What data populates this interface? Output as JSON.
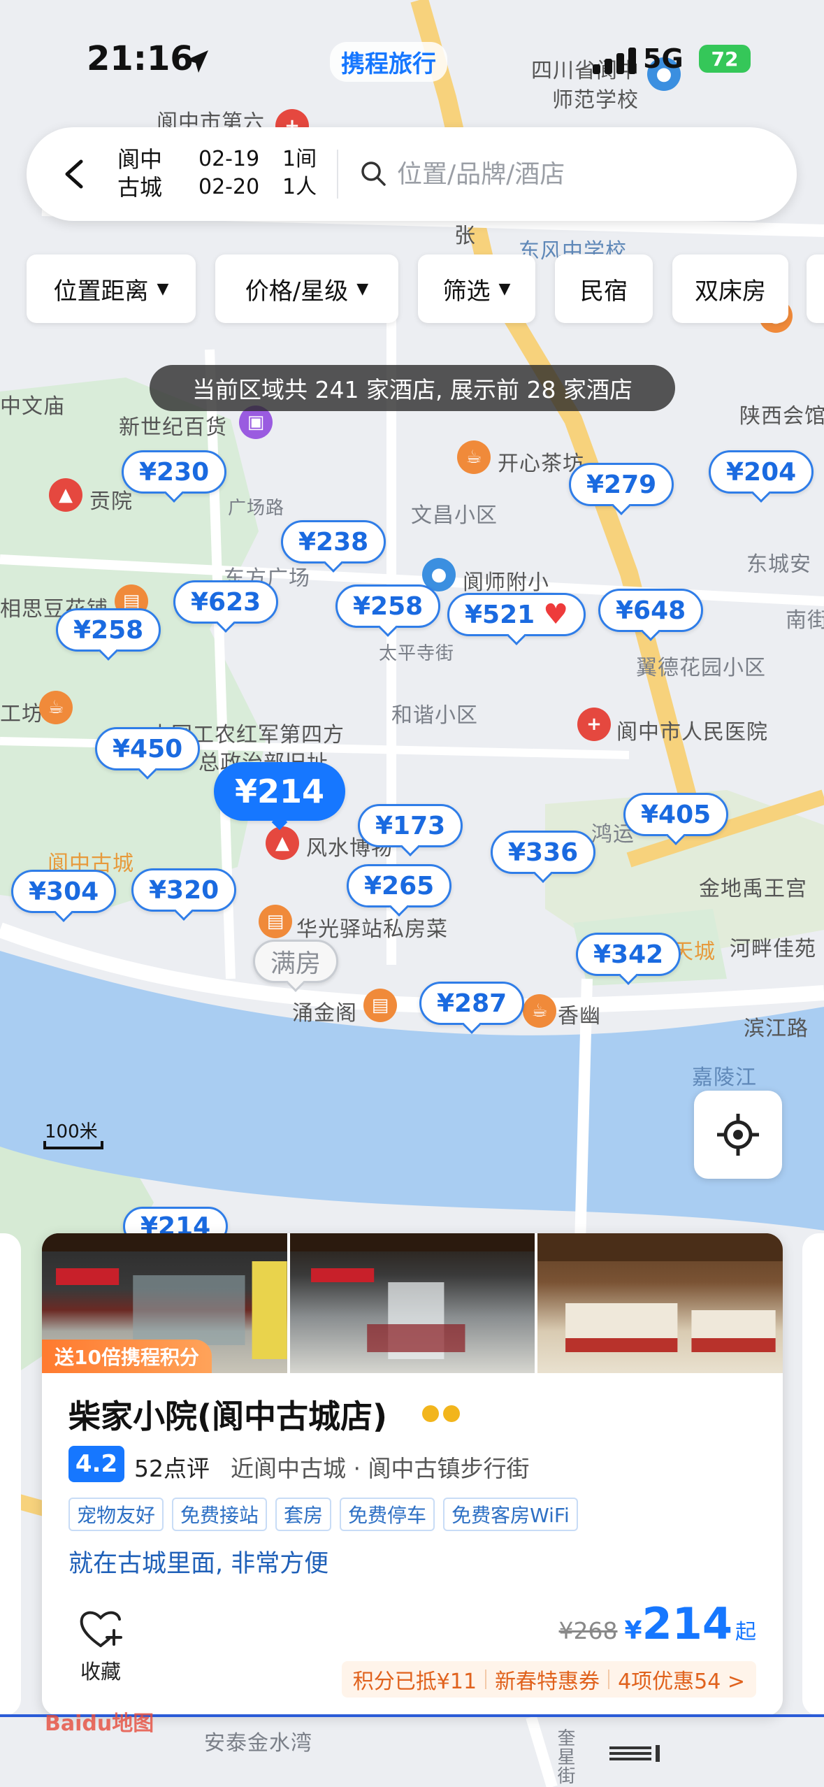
{
  "status_bar": {
    "time": "21:16",
    "app_brand": "携程旅行",
    "network": "5G",
    "battery": "72"
  },
  "search": {
    "city_line1": "阆中",
    "city_line2": "古城",
    "checkin": "02-19",
    "checkout": "02-20",
    "rooms": "1间",
    "guests": "1人",
    "placeholder": "位置/品牌/酒店"
  },
  "filters": [
    {
      "label": "位置距离",
      "dropdown": true
    },
    {
      "label": "价格/星级",
      "dropdown": true
    },
    {
      "label": "筛选",
      "dropdown": true
    },
    {
      "label": "民宿",
      "dropdown": false
    },
    {
      "label": "双床房",
      "dropdown": false
    }
  ],
  "notice": "当前区域共 241 家酒店, 展示前 28 家酒店",
  "map": {
    "scale_label": "100米",
    "labels": [
      "阆中市第六",
      "四川省阆中",
      "师范学校",
      "东风中学校",
      "中文庙",
      "新世纪百货",
      "陕西会馆",
      "开心茶坊",
      "贡院",
      "广场路",
      "文昌小区",
      "东方广场",
      "阆师附小",
      "东城安",
      "南街",
      "相思豆花铺",
      "太平寺街",
      "翼德花园小区",
      "和谐小区",
      "阆中市人民医院",
      "工坊",
      "中国工农红军第四方",
      "总政治部旧址",
      "阆中古城",
      "风水博物",
      "鸿运",
      "金地禹王宫",
      "华光驿站私房菜",
      "天城",
      "河畔佳苑",
      "涌金阁",
      "香幽",
      "滨江路",
      "嘉陵江",
      "安泰金水湾",
      "奎星街",
      "张"
    ],
    "pins": [
      {
        "price": "¥230"
      },
      {
        "price": "¥279"
      },
      {
        "price": "¥204"
      },
      {
        "price": "¥238"
      },
      {
        "price": "¥623"
      },
      {
        "price": "¥258"
      },
      {
        "price": "¥258"
      },
      {
        "price": "¥521"
      },
      {
        "price": "¥648"
      },
      {
        "price": "¥450"
      },
      {
        "price": "¥214"
      },
      {
        "price": "¥173"
      },
      {
        "price": "¥405"
      },
      {
        "price": "¥336"
      },
      {
        "price": "¥304"
      },
      {
        "price": "¥320"
      },
      {
        "price": "¥265"
      },
      {
        "price": "¥342"
      },
      {
        "price": "¥287"
      },
      {
        "price": "满房"
      },
      {
        "price": "¥214"
      }
    ]
  },
  "hotel": {
    "promo": "送10倍携程积分",
    "name": "柴家小院(阆中古城店)",
    "score": "4.2",
    "reviews": "52点评",
    "location": "近阆中古城 · 阆中古镇步行街",
    "tags": [
      "宠物友好",
      "免费接站",
      "套房",
      "免费停车",
      "免费客房WiFi"
    ],
    "highlight": "就在古城里面, 非常方便",
    "favorite_label": "收藏",
    "old_price": "¥268",
    "currency": "¥",
    "price": "214",
    "price_suffix": "起",
    "discounts": [
      "积分已抵¥11",
      "新春特惠券",
      "4项优惠54 >"
    ]
  },
  "footer": {
    "baidu": "Baidu地图"
  }
}
